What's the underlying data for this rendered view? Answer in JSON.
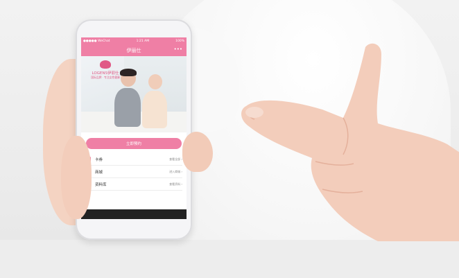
{
  "status_bar": {
    "carrier": "●●●●● WeChat",
    "time": "1:21 AM",
    "battery": "100%"
  },
  "nav": {
    "title": "伊丽仕",
    "more_icon": "more-dots-icon"
  },
  "banner": {
    "brand": "LOGENS伊丽仕",
    "tagline": "国际品牌 · 专注女性健康"
  },
  "cta": {
    "label": "立即预约"
  },
  "menu": [
    {
      "label": "卡券",
      "meta": "查看全部 ›",
      "icon": "coupon-icon"
    },
    {
      "label": "商城",
      "meta": "进入商城 ›",
      "icon": "shop-icon"
    },
    {
      "label": "资料库",
      "meta": "查看资料 ›",
      "icon": "library-icon"
    }
  ],
  "colors": {
    "accent": "#ef7fa5"
  }
}
